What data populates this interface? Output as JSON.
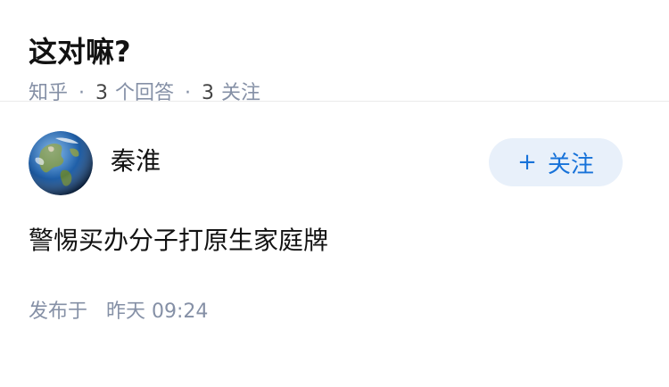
{
  "question": {
    "title": "这对嘛?",
    "source": "知乎",
    "separator": "·",
    "answer_count": "3",
    "answer_label": "个回答",
    "follower_count": "3",
    "follower_label": "关注"
  },
  "answer": {
    "author": {
      "name": "秦淮",
      "avatar_icon": "earth-globe-avatar"
    },
    "follow_button": {
      "icon": "+",
      "label": "关注"
    },
    "content": "警惕买办分子打原生家庭牌",
    "published_label": "发布于",
    "published_time": "昨天 09:24"
  },
  "colors": {
    "meta_gray": "#8590a6",
    "follow_blue": "#1772d9",
    "follow_bg": "#e8f0fa",
    "divider": "#ebebeb"
  }
}
